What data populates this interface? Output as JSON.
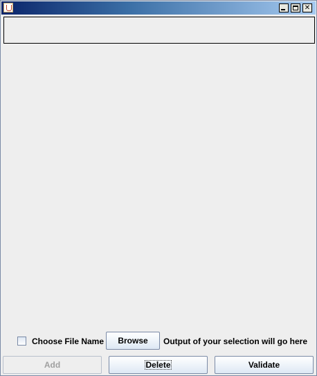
{
  "window": {
    "title": ""
  },
  "top_field": {
    "value": ""
  },
  "file_row": {
    "checkbox_label": "Choose File Name",
    "browse_label": "Browse",
    "output_text": "Output of your selection will go here"
  },
  "buttons": {
    "add": "Add",
    "delete": "Delete",
    "validate": "Validate"
  }
}
